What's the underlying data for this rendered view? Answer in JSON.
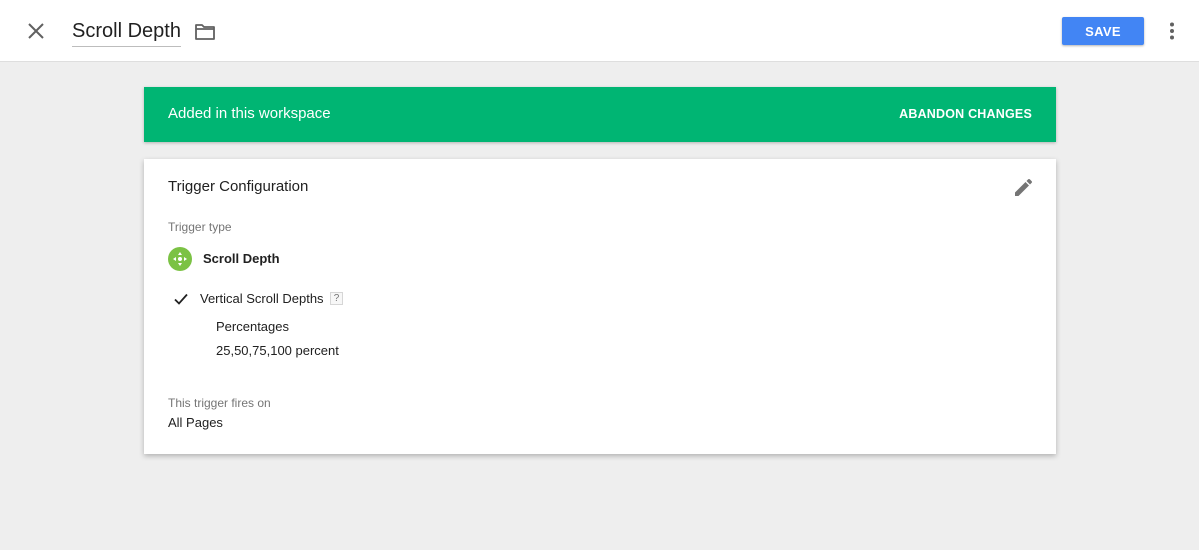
{
  "header": {
    "title": "Scroll Depth",
    "save_label": "SAVE",
    "icons": {
      "close": "close-icon",
      "folder": "folder-icon",
      "more": "more-vert-icon"
    },
    "save_color": "#4285f4"
  },
  "banner": {
    "text": "Added in this workspace",
    "action_label": "ABANDON CHANGES",
    "color": "#00b573"
  },
  "card": {
    "title": "Trigger Configuration",
    "edit_icon": "pencil-icon",
    "trigger_type_label": "Trigger type",
    "trigger_type_name": "Scroll Depth",
    "trigger_type_icon": "scroll-depth-icon",
    "trigger_type_icon_color": "#7bc244",
    "vertical_scroll": {
      "checked": true,
      "label": "Vertical Scroll Depths",
      "help_label": "?",
      "mode": "Percentages",
      "values": "25,50,75,100 percent"
    },
    "fires_on_label": "This trigger fires on",
    "fires_on_value": "All Pages"
  }
}
